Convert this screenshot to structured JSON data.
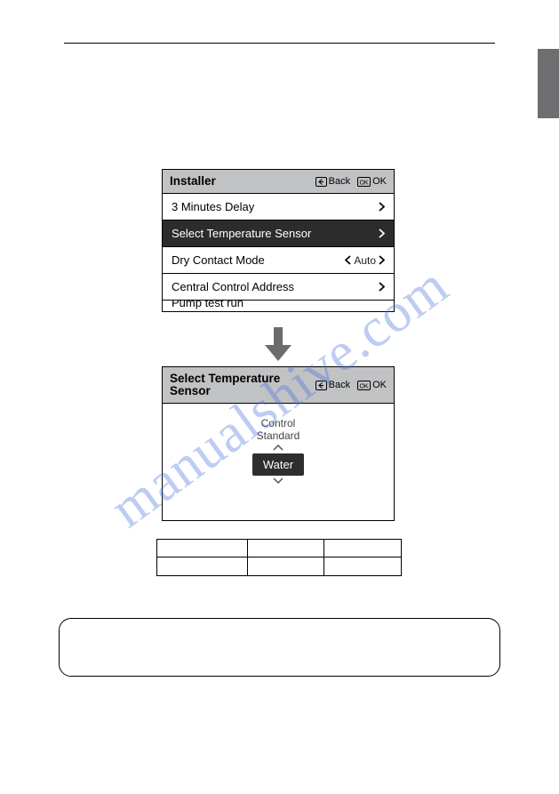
{
  "watermark": "manualshive.com",
  "screen1": {
    "title": "Installer",
    "back": "Back",
    "ok": "OK",
    "items": [
      {
        "label": "3 Minutes Delay"
      },
      {
        "label": "Select Temperature Sensor",
        "selected": true
      },
      {
        "label": "Dry Contact Mode",
        "value": "Auto"
      },
      {
        "label": "Central Control Address"
      },
      {
        "label": "Pump test run",
        "cut": true
      }
    ]
  },
  "screen2": {
    "title": "Select Temperature Sensor",
    "back": "Back",
    "ok": "OK",
    "control_label_line1": "Control",
    "control_label_line2": "Standard",
    "value": "Water"
  }
}
